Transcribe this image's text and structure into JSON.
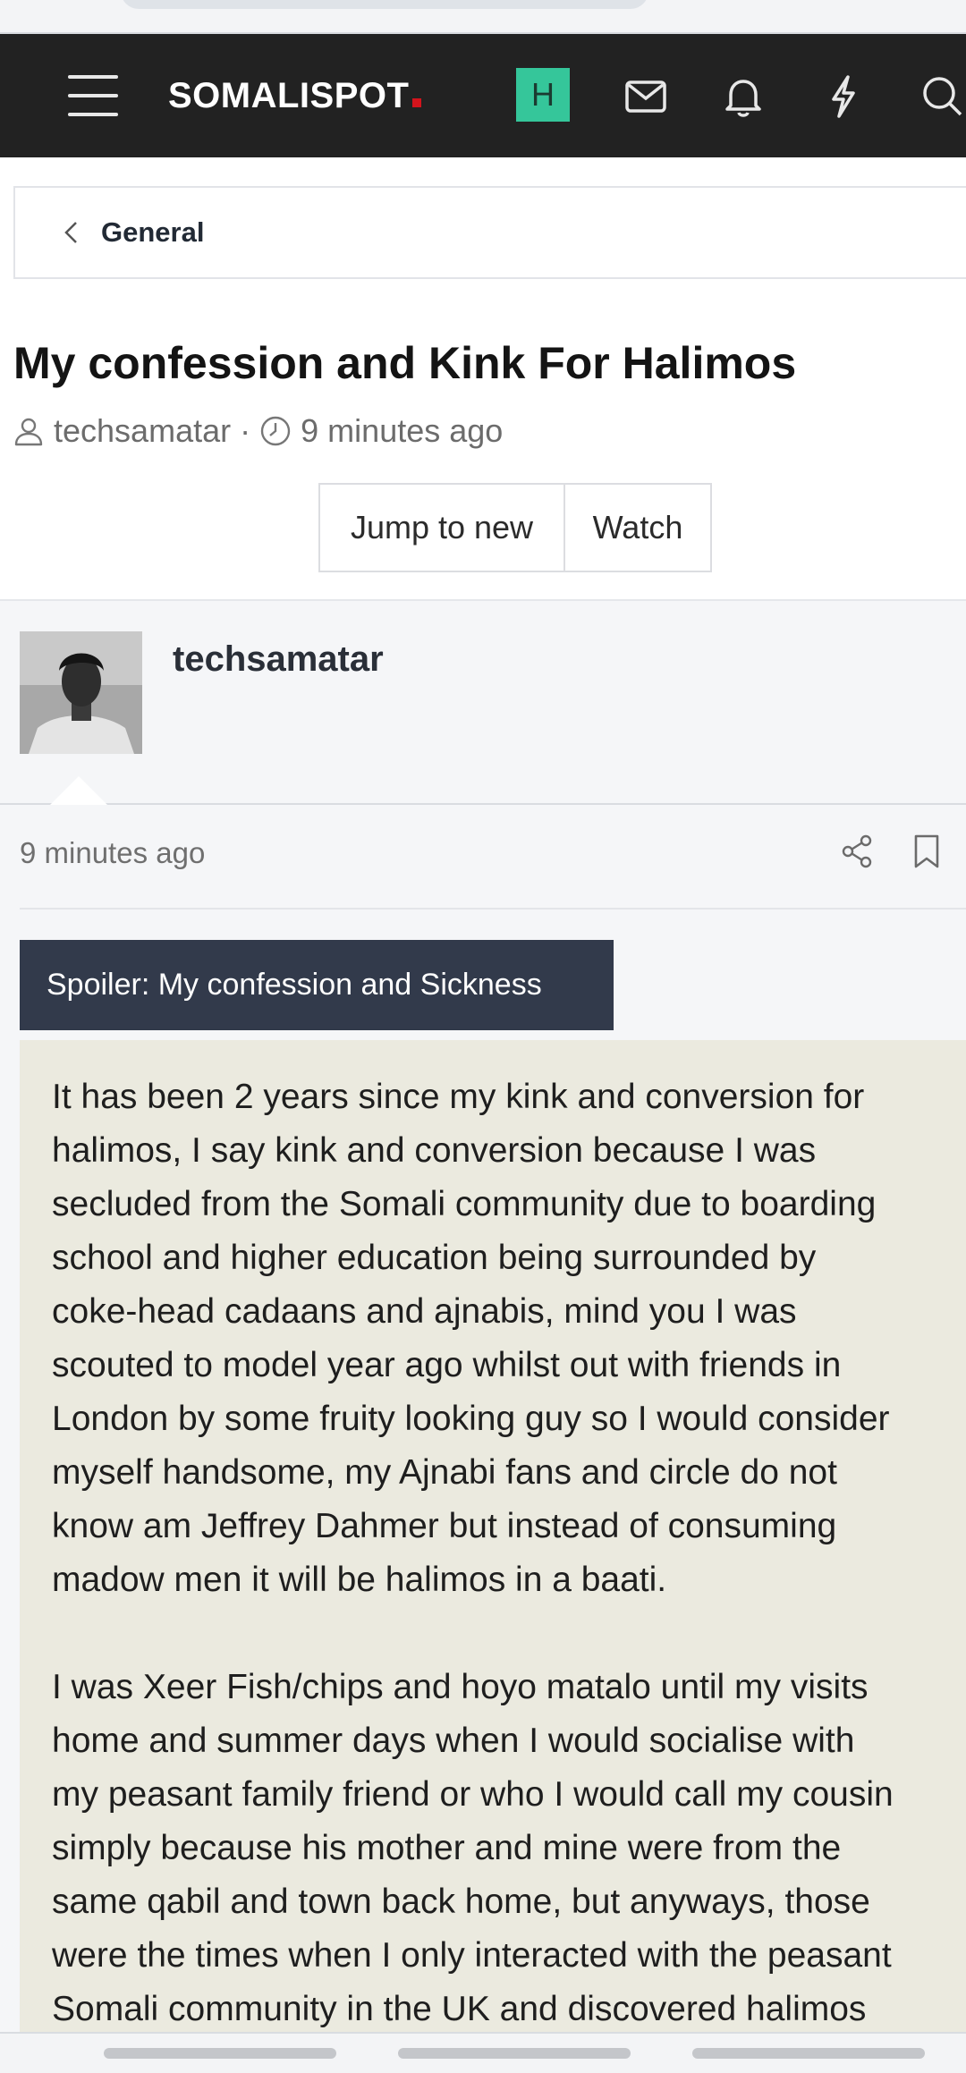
{
  "navbar": {
    "logo": "SOMALISPOT",
    "user_initial": "H",
    "icons": [
      "menu-icon",
      "inbox-icon",
      "bell-icon",
      "lightning-icon",
      "search-icon"
    ]
  },
  "breadcrumb": {
    "label": "General"
  },
  "thread": {
    "title": "My confession and Kink For Halimos",
    "author": "techsamatar",
    "separator": "·",
    "time": "9 minutes ago"
  },
  "actions": {
    "jump_to_new": "Jump to new",
    "watch": "Watch"
  },
  "post": {
    "username": "techsamatar",
    "time": "9 minutes ago",
    "spoiler_label": "Spoiler: My confession and Sickness",
    "paragraph1": "It has been 2 years since my kink and conversion for\nhalimos, I say kink and conversion because I was\nsecluded from the Somali community due to boarding\nschool and higher education being surrounded by\ncoke-head cadaans and ajnabis, mind you I was\nscouted to model year ago whilst out with friends in\nLondon by some fruity looking guy so I would consider\nmyself handsome, my Ajnabi fans and circle do not\nknow am Jeffrey Dahmer but instead of consuming\nmadow men it will be halimos in a baati.",
    "paragraph2": "I was Xeer Fish/chips and hoyo matalo until my visits\nhome and summer days when I would socialise with\nmy peasant family friend or who I would call my cousin\nsimply because his mother and mine were from the\nsame qabil and town back home, but anyways, those\nwere the times when I only interacted with the peasant\nSomali community in the UK and discovered halimos"
  },
  "colors": {
    "navbar_bg": "#222222",
    "avatar_badge": "#35c69a",
    "logo_dot": "#d4141c",
    "spoiler_button": "#323a4b",
    "spoiler_background": "#ebeadf"
  }
}
